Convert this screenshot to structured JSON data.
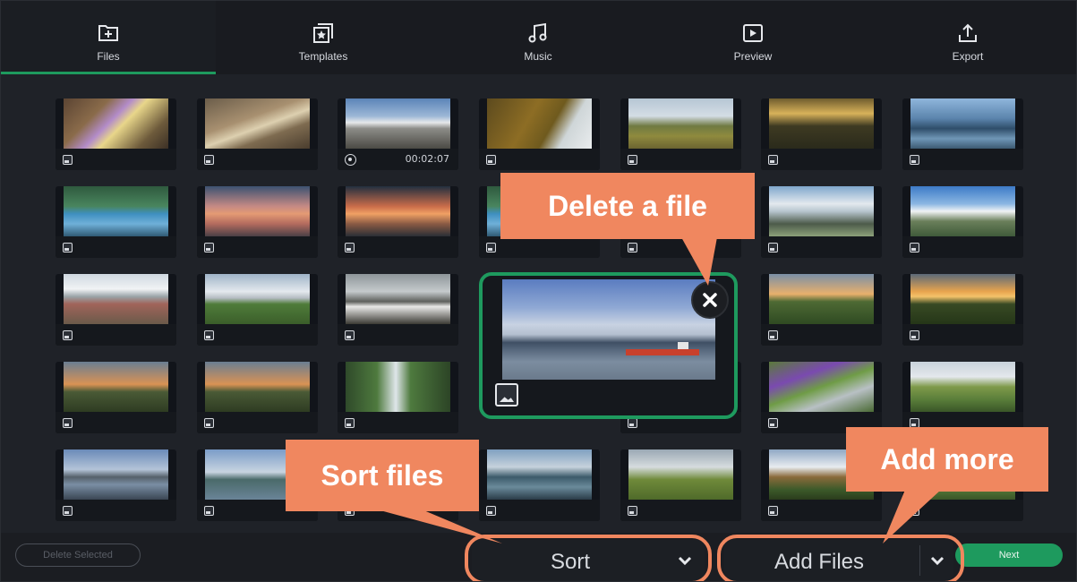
{
  "tabs": [
    {
      "label": "Files",
      "icon": "files-add-icon",
      "active": true
    },
    {
      "label": "Templates",
      "icon": "templates-star-icon",
      "active": false
    },
    {
      "label": "Music",
      "icon": "music-note-icon",
      "active": false
    },
    {
      "label": "Preview",
      "icon": "play-preview-icon",
      "active": false
    },
    {
      "label": "Export",
      "icon": "export-upload-icon",
      "active": false
    }
  ],
  "thumbnails": {
    "video_duration": "00:02:07"
  },
  "bottom_bar": {
    "delete_selected_label": "Delete Selected",
    "sort_label": "Sort",
    "add_files_label": "Add Files",
    "next_label": "Next"
  },
  "callouts": {
    "delete_file": "Delete a file",
    "sort_files": "Sort files",
    "add_more": "Add more"
  },
  "colors": {
    "accent_green": "#1e9a5e",
    "callout_orange": "#f0875f",
    "background": "#1f2228"
  }
}
